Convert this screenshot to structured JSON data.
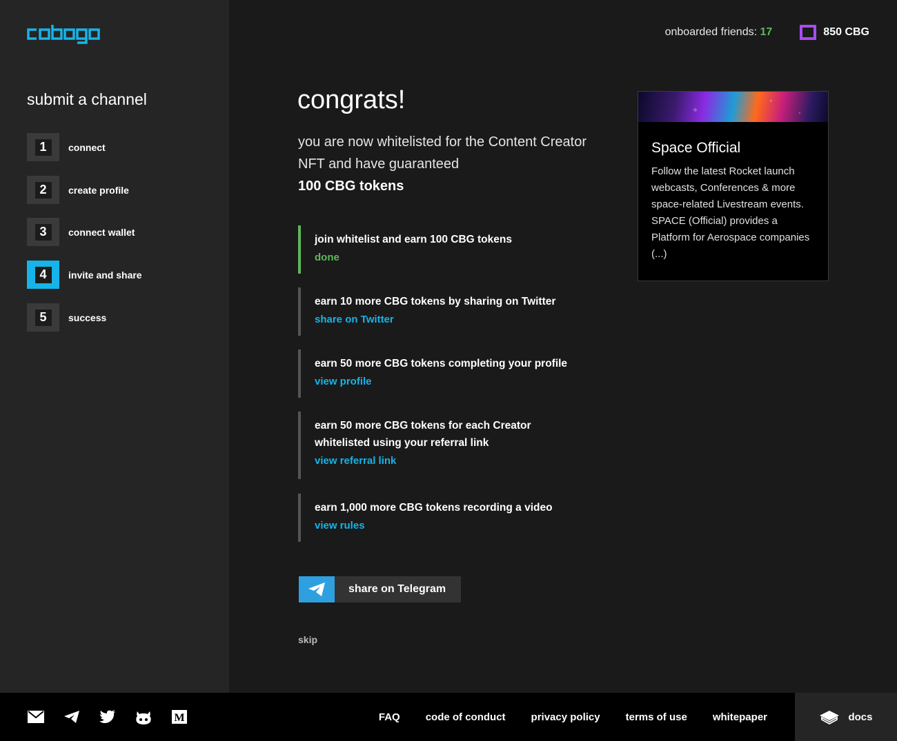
{
  "brand": {
    "name": "cobogo",
    "accent": "#16b4e8"
  },
  "header": {
    "friends_label": "onboarded friends:",
    "friends_count": "17",
    "wallet_balance": "850 CBG"
  },
  "sidebar": {
    "title": "submit a channel",
    "steps": [
      {
        "num": "1",
        "label": "connect"
      },
      {
        "num": "2",
        "label": "create profile"
      },
      {
        "num": "3",
        "label": "connect wallet"
      },
      {
        "num": "4",
        "label": "invite and share",
        "active": true
      },
      {
        "num": "5",
        "label": "success"
      }
    ]
  },
  "main": {
    "heading": "congrats!",
    "intro": "you are now whitelisted for the Content Creator NFT and have guaranteed",
    "intro_bold": "100 CBG tokens",
    "tasks": [
      {
        "title": "join whitelist and earn 100 CBG tokens",
        "action": "done",
        "status": "done"
      },
      {
        "title": "earn 10 more CBG tokens by sharing on Twitter",
        "action": "share on Twitter"
      },
      {
        "title": "earn 50 more CBG tokens completing your profile",
        "action": "view profile"
      },
      {
        "title": "earn 50 more CBG tokens for each Creator whitelisted using your referral link",
        "action": "view referral link"
      },
      {
        "title": "earn 1,000 more CBG tokens recording a video",
        "action": "view rules"
      }
    ],
    "telegram_button": "share on Telegram",
    "skip": "skip"
  },
  "card": {
    "title": "Space Official",
    "description": "Follow the latest Rocket launch webcasts, Conferences & more space-related Livestream events. SPACE (Official) provides a Platform for Aerospace companies (...)"
  },
  "footer": {
    "social_icons": [
      "mail-icon",
      "telegram-icon",
      "twitter-icon",
      "github-icon",
      "medium-icon"
    ],
    "links": [
      "FAQ",
      "code of conduct",
      "privacy policy",
      "terms of use",
      "whitepaper"
    ],
    "docs": "docs"
  },
  "colors": {
    "green": "#5db85c",
    "purple": "#a64df0",
    "telegram_blue": "#2ea0e0"
  }
}
